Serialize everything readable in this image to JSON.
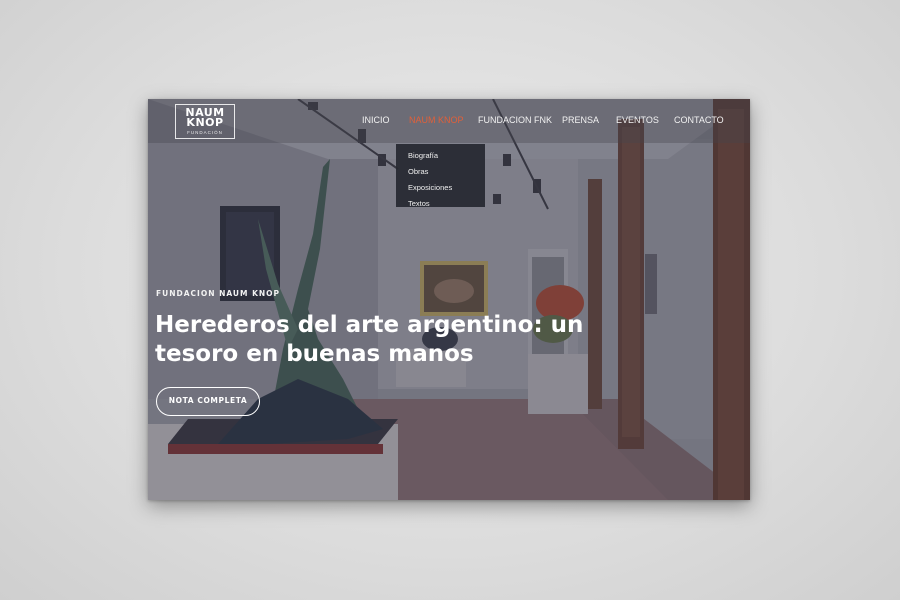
{
  "logo": {
    "line1": "NAUM",
    "line2": "KNOP",
    "line3": "FUNDACIÓN"
  },
  "nav": {
    "items": [
      {
        "label": "INICIO"
      },
      {
        "label": "NAUM KNOP",
        "active": true
      },
      {
        "label": "FUNDACION FNK"
      },
      {
        "label": "PRENSA"
      },
      {
        "label": "EVENTOS"
      },
      {
        "label": "CONTACTO"
      }
    ],
    "dropdown": [
      {
        "label": "Biografía"
      },
      {
        "label": "Obras"
      },
      {
        "label": "Exposiciones"
      },
      {
        "label": "Textos"
      }
    ]
  },
  "hero": {
    "eyebrow": "FUNDACION NAUM KNOP",
    "headline": "Herederos del arte argentino: un tesoro en buenas manos",
    "cta_label": "NOTA COMPLETA"
  },
  "colors": {
    "accent": "#e0603a",
    "overlay": "#28263480",
    "nav_text": "#f2f2f2"
  }
}
